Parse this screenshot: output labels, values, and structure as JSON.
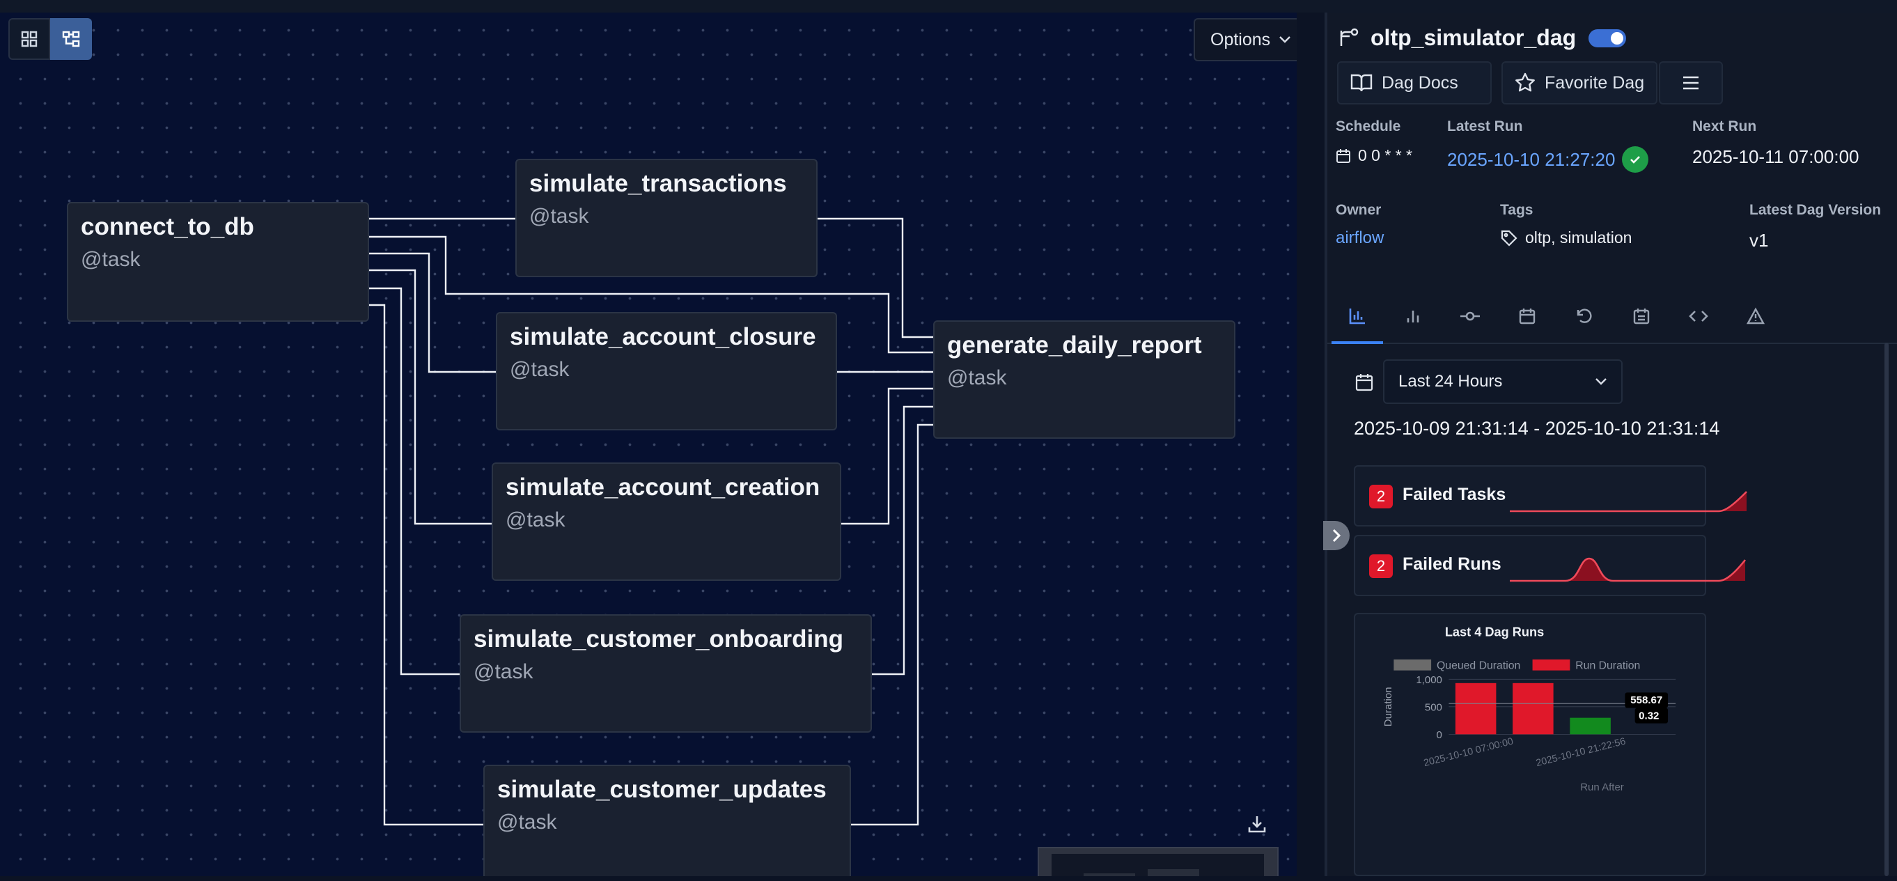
{
  "canvas": {
    "view_buttons": [
      {
        "icon": "grid-icon",
        "active": false
      },
      {
        "icon": "graph-icon",
        "active": true
      }
    ],
    "options_label": "Options",
    "nodes": [
      {
        "id": "connect_to_db",
        "type": "@task"
      },
      {
        "id": "simulate_transactions",
        "type": "@task"
      },
      {
        "id": "simulate_account_closure",
        "type": "@task"
      },
      {
        "id": "simulate_account_creation",
        "type": "@task"
      },
      {
        "id": "simulate_customer_onboarding",
        "type": "@task"
      },
      {
        "id": "simulate_customer_updates",
        "type": "@task"
      },
      {
        "id": "generate_daily_report",
        "type": "@task"
      }
    ],
    "edges": [
      [
        "connect_to_db",
        "simulate_transactions"
      ],
      [
        "connect_to_db",
        "simulate_account_closure"
      ],
      [
        "connect_to_db",
        "simulate_account_creation"
      ],
      [
        "connect_to_db",
        "simulate_customer_onboarding"
      ],
      [
        "connect_to_db",
        "simulate_customer_updates"
      ],
      [
        "connect_to_db",
        "generate_daily_report"
      ],
      [
        "simulate_transactions",
        "generate_daily_report"
      ],
      [
        "simulate_account_closure",
        "generate_daily_report"
      ],
      [
        "simulate_account_creation",
        "generate_daily_report"
      ],
      [
        "simulate_customer_onboarding",
        "generate_daily_report"
      ],
      [
        "simulate_customer_updates",
        "generate_daily_report"
      ]
    ]
  },
  "panel": {
    "dag_name": "oltp_simulator_dag",
    "paused": false,
    "buttons": {
      "docs": "Dag Docs",
      "favorite": "Favorite Dag"
    },
    "schedule": {
      "label": "Schedule",
      "value": "0 0 * * *"
    },
    "latest_run": {
      "label": "Latest Run",
      "value": "2025-10-10 21:27:20",
      "status": "success"
    },
    "next_run": {
      "label": "Next Run",
      "value": "2025-10-11 07:00:00"
    },
    "owner": {
      "label": "Owner",
      "value": "airflow"
    },
    "tags": {
      "label": "Tags",
      "value": "oltp, simulation"
    },
    "version": {
      "label": "Latest Dag Version",
      "value": "v1"
    },
    "tabs": [
      "overview",
      "grid",
      "graph",
      "calendar",
      "backfills",
      "events",
      "code",
      "warnings"
    ],
    "range": {
      "selected": "Last 24 Hours",
      "text": "2025-10-09 21:31:14 - 2025-10-10 21:31:14"
    },
    "failed_tasks": {
      "count": "2",
      "label": "Failed Tasks"
    },
    "failed_runs": {
      "count": "2",
      "label": "Failed Runs"
    },
    "colors": {
      "accent": "#3b82f6",
      "failed": "#e0182a",
      "success": "#1e9e48",
      "queued": "#6b6b6b",
      "link": "#6aa5ff"
    }
  },
  "chart_data": {
    "type": "bar",
    "title": "Last 4 Dag Runs",
    "legend": [
      {
        "name": "Queued Duration",
        "color": "#6b6b6b"
      },
      {
        "name": "Run Duration",
        "color": "#e0182a"
      }
    ],
    "ylabel": "Duration",
    "xlabel": "Run After",
    "ylim": [
      0,
      1000
    ],
    "yticks": [
      "1,000",
      "500",
      "0"
    ],
    "categories": [
      "2025-10-10 07:00:00",
      "",
      "2025-10-10 21:22:56"
    ],
    "x_tick_labels": [
      "2025-10-10 07:00:00",
      "2025-10-10 21:22:56"
    ],
    "series": [
      {
        "name": "Queued Duration",
        "values": [
          0,
          0,
          0
        ]
      },
      {
        "name": "Run Duration",
        "values": [
          930,
          930,
          300
        ],
        "colors": [
          "#e0182a",
          "#e0182a",
          "#128a1e"
        ]
      }
    ],
    "reference_line": {
      "value": 558.67,
      "label": "558.67"
    },
    "tooltip_label": "0.32",
    "legend_position": "top"
  }
}
